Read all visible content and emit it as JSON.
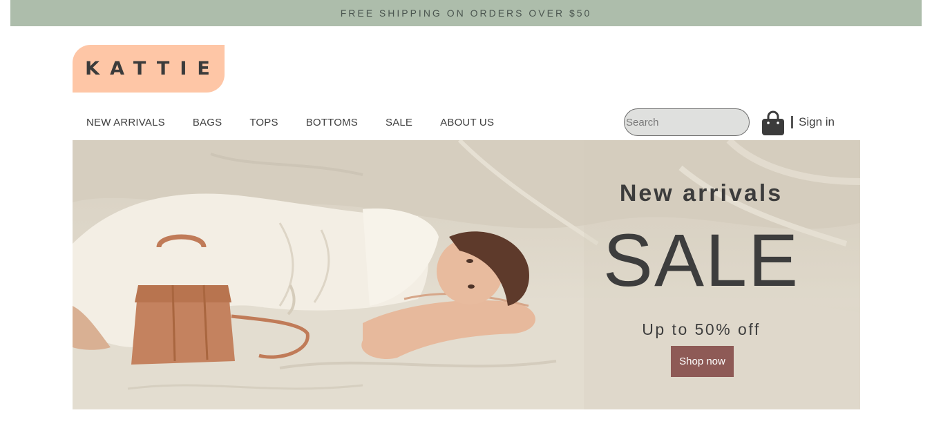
{
  "promo": {
    "text": "FREE SHIPPING ON ORDERS OVER $50"
  },
  "brand": {
    "logo_text": "KATTIE",
    "logo_color": "#fec6a6"
  },
  "nav": {
    "items": [
      {
        "label": "NEW ARRIVALS"
      },
      {
        "label": "BAGS"
      },
      {
        "label": "TOPS"
      },
      {
        "label": "BOTTOMS"
      },
      {
        "label": "SALE"
      },
      {
        "label": "ABOUT US"
      }
    ]
  },
  "header": {
    "search_placeholder": "Search",
    "cart_icon": "shopping-bag-icon",
    "sign_in_label": "Sign in"
  },
  "hero": {
    "subtitle": "New arrivals",
    "title": "SALE",
    "discount": "Up to 50% off",
    "cta_label": "Shop now",
    "cta_color": "#8e5a56"
  },
  "colors": {
    "promo_bar": "#adbdab",
    "text": "#3f3f3f"
  }
}
